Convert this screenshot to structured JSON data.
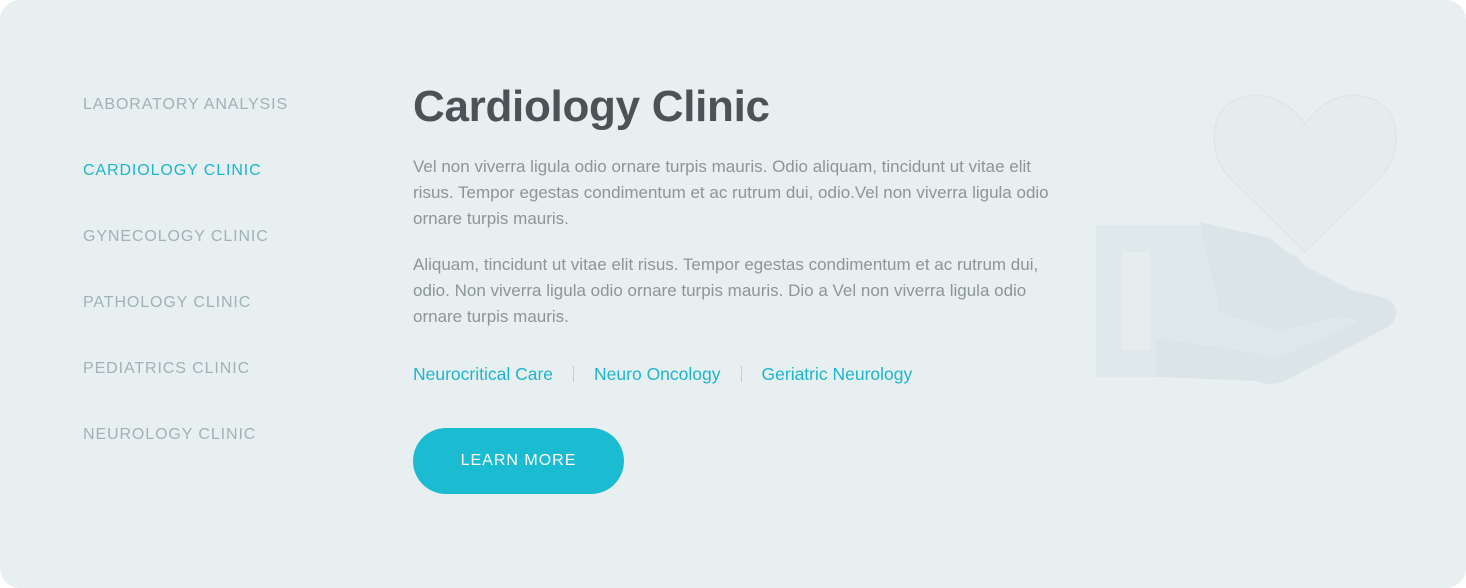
{
  "tabs": [
    {
      "label": "LABORATORY ANALYSIS"
    },
    {
      "label": "CARDIOLOGY CLINIC"
    },
    {
      "label": "GYNECOLOGY CLINIC"
    },
    {
      "label": "PATHOLOGY CLINIC"
    },
    {
      "label": "PEDIATRICS CLINIC"
    },
    {
      "label": "NEUROLOGY CLINIC"
    }
  ],
  "active_tab": "CARDIOLOGY CLINIC",
  "content": {
    "title": "Cardiology Clinic",
    "paragraph1": "Vel non viverra ligula odio ornare turpis mauris. Odio aliquam, tincidunt ut vitae elit risus. Tempor egestas condimentum et ac rutrum dui, odio.Vel non viverra ligula odio ornare turpis mauris.",
    "paragraph2": "Aliquam, tincidunt ut vitae elit risus. Tempor egestas condimentum et ac rutrum dui, odio. Non viverra ligula odio ornare turpis mauris. Dio a Vel non viverra ligula odio ornare turpis mauris.",
    "links": [
      {
        "label": "Neurocritical Care"
      },
      {
        "label": "Neuro Oncology"
      },
      {
        "label": "Geriatric Neurology"
      }
    ],
    "button_label": "LEARN MORE"
  },
  "decoration_icon": "heart-in-hand-icon",
  "colors": {
    "background": "#e8eff1",
    "accent": "#1bb6cc",
    "title": "#4b5356",
    "body_text": "#8c9597",
    "inactive_tab": "#9fb2b5"
  }
}
